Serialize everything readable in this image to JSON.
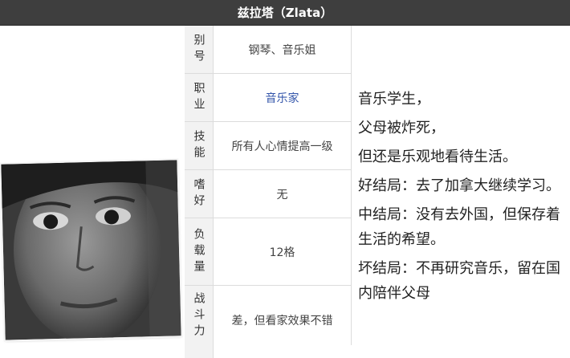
{
  "header": {
    "title": "兹拉塔（Zlata）"
  },
  "rows": [
    {
      "label": "别号",
      "value": "钢琴、音乐姐",
      "link": false
    },
    {
      "label": "职业",
      "value": "音乐家",
      "link": true
    },
    {
      "label": "技能",
      "value": "所有人心情提高一级",
      "link": false
    },
    {
      "label": "嗜好",
      "value": "无",
      "link": false
    },
    {
      "label": "负载量",
      "value": "12格",
      "link": false
    },
    {
      "label": "战斗力",
      "value": "差，但看家效果不错",
      "link": false
    }
  ],
  "description": {
    "lines": [
      "音乐学生，",
      "父母被炸死，",
      "但还是乐观地看待生活。",
      "好结局：去了加拿大继续学习。",
      "中结局：没有去外国，但保存着生活的希望。",
      "坏结局：不再研究音乐，留在国内陪伴父母"
    ]
  }
}
